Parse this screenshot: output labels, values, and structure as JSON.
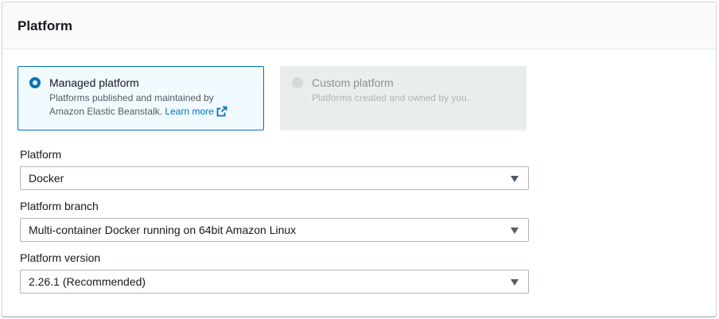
{
  "panel": {
    "title": "Platform"
  },
  "platform_type": {
    "managed": {
      "label": "Managed platform",
      "description_line1": "Platforms published and maintained by",
      "description_line2": "Amazon Elastic Beanstalk.",
      "learn_more": "Learn more",
      "selected": true
    },
    "custom": {
      "label": "Custom platform",
      "description": "Platforms created and owned by you.",
      "disabled": true
    }
  },
  "fields": {
    "platform": {
      "label": "Platform",
      "value": "Docker"
    },
    "platform_branch": {
      "label": "Platform branch",
      "value": "Multi-container Docker running on 64bit Amazon Linux"
    },
    "platform_version": {
      "label": "Platform version",
      "value": "2.26.1 (Recommended)"
    }
  },
  "icons": {
    "external_link": "external-link-icon",
    "dropdown": "caret-down-icon"
  },
  "colors": {
    "accent": "#0073bb",
    "selected_tile_bg": "#f1faff",
    "disabled_tile_bg": "#eaeded"
  }
}
